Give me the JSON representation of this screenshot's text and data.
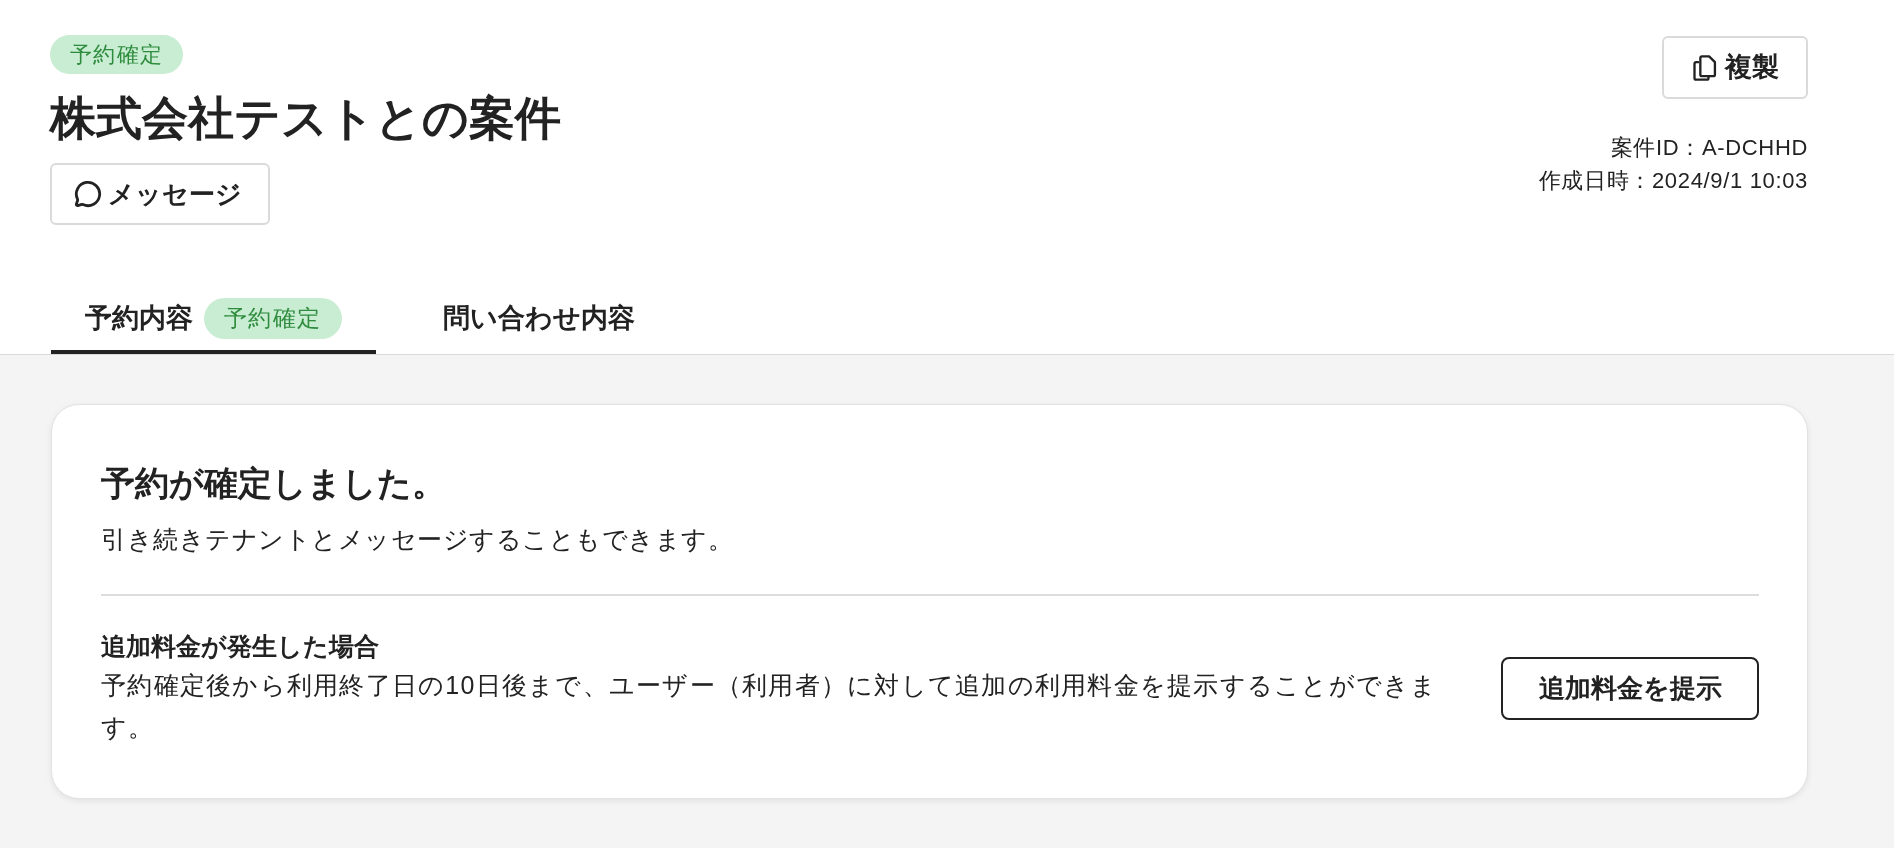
{
  "header": {
    "status_badge": "予約確定",
    "title": "株式会社テストとの案件",
    "message_button": "メッセージ",
    "copy_button": "複製",
    "case_id": "案件ID：A-DCHHD",
    "created_at": "作成日時：2024/9/1 10:03"
  },
  "tabs": [
    {
      "label": "予約内容",
      "badge": "予約確定",
      "selected": true
    },
    {
      "label": "問い合わせ内容",
      "selected": false
    }
  ],
  "card": {
    "title": "予約が確定しました。",
    "description": "引き続きテナントとメッセージすることもできます。",
    "section": {
      "title": "追加料金が発生した場合",
      "description": "予約確定後から利用終了日の10日後まで、ユーザー（利用者）に対して追加の利用料金を提示することができます。",
      "button": "追加料金を提示"
    }
  }
}
